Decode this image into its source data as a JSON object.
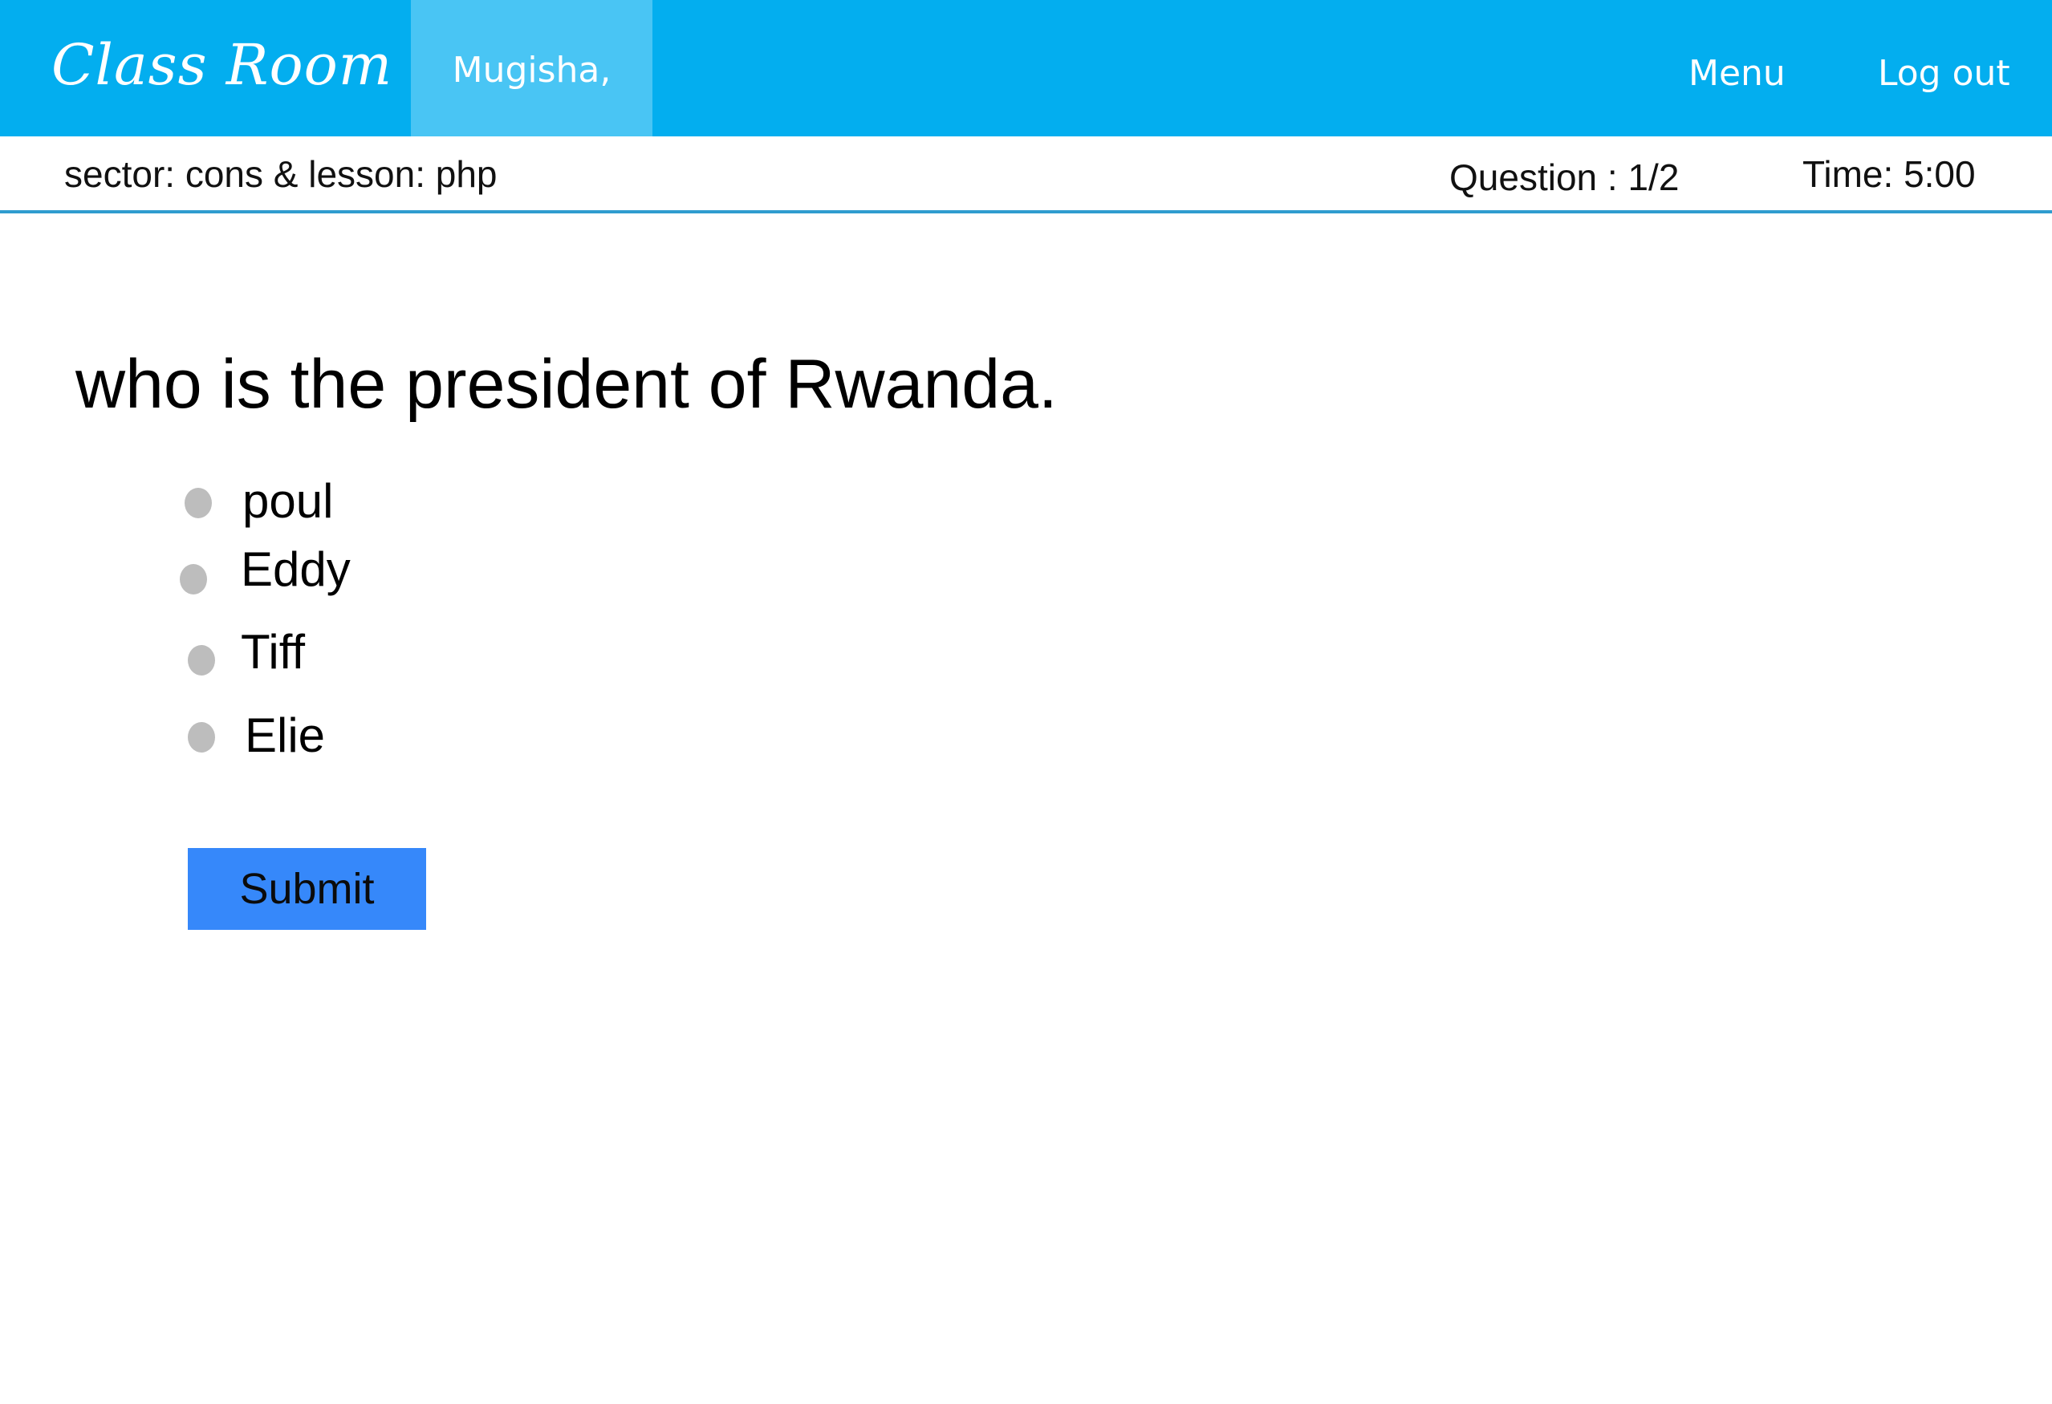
{
  "app": {
    "brand": "Class  Room",
    "user_name": "Mugisha,"
  },
  "nav": {
    "menu_label": "Menu",
    "logout_label": "Log out"
  },
  "info": {
    "sector_lesson": "sector: cons  &  lesson: php",
    "question_counter": "Question : 1/2",
    "time": "Time:  5:00"
  },
  "quiz": {
    "question": "who is the president of Rwanda.",
    "options": [
      {
        "label": "poul"
      },
      {
        "label": "Eddy"
      },
      {
        "label": "Tiff"
      },
      {
        "label": "Elie"
      }
    ],
    "submit_label": "Submit"
  },
  "colors": {
    "navbar": "#03aeef",
    "user_tab": "#49c5f4",
    "divider": "#2f9ccf",
    "submit": "#3688fa",
    "radio": "#bdbdbd"
  }
}
